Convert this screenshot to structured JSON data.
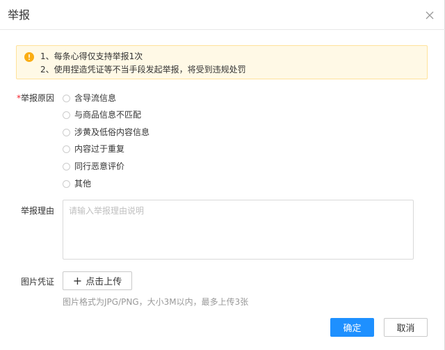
{
  "dialog": {
    "title": "举报",
    "close_icon": "close-icon"
  },
  "notice": {
    "icon": "warning-icon",
    "line1": "1、每条心得仅支持举报1次",
    "line2": "2、使用捏造凭证等不当手段发起举报，将受到违规处罚",
    "colors": {
      "background": "#fff9e6",
      "border": "#ffe29a",
      "icon": "#faad14"
    }
  },
  "reason": {
    "required_mark": "*",
    "label": "举报原因",
    "options": [
      "含导流信息",
      "与商品信息不匹配",
      "涉黄及低俗内容信息",
      "内容过于重复",
      "同行恶意评价",
      "其他"
    ],
    "selected": null
  },
  "detail": {
    "label": "举报理由",
    "value": "",
    "placeholder": "请输入举报理由说明"
  },
  "image": {
    "label": "图片凭证",
    "upload_icon": "plus-icon",
    "upload_plus": "+",
    "upload_label": "点击上传",
    "hint": "图片格式为JPG/PNG，大小3M以内，最多上传3张"
  },
  "footer": {
    "ok_label": "确定",
    "cancel_label": "取消",
    "colors": {
      "primary": "#1e90ff",
      "required": "#f5222d"
    }
  }
}
